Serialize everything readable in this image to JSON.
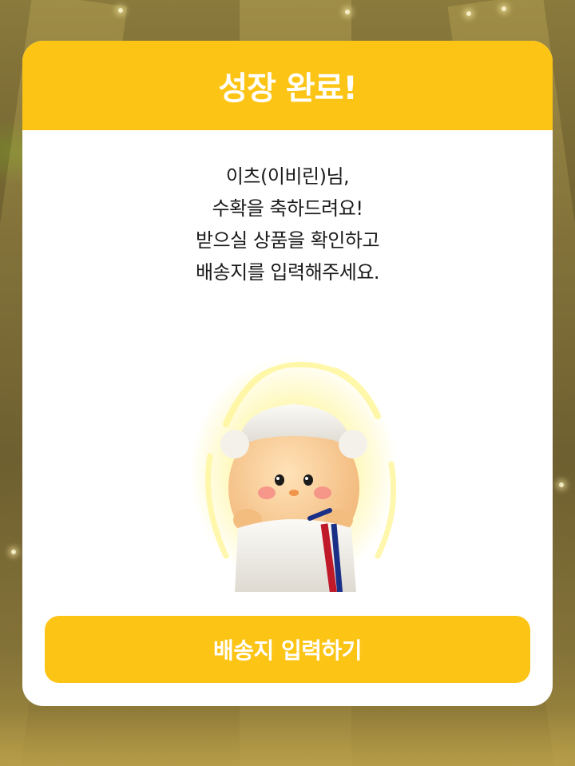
{
  "modal": {
    "title": "성장 완료!",
    "message_lines": [
      "이츠(이비린)님,",
      "수확을 축하드려요!",
      "받으실 상품을 확인하고",
      "배송지를 입력해주세요."
    ],
    "character_icon": "towel-wrapped-character-illustration",
    "button_label": "배송지 입력하기"
  },
  "colors": {
    "accent": "#fcc414",
    "text": "#1a1a1a",
    "surface": "#ffffff"
  }
}
